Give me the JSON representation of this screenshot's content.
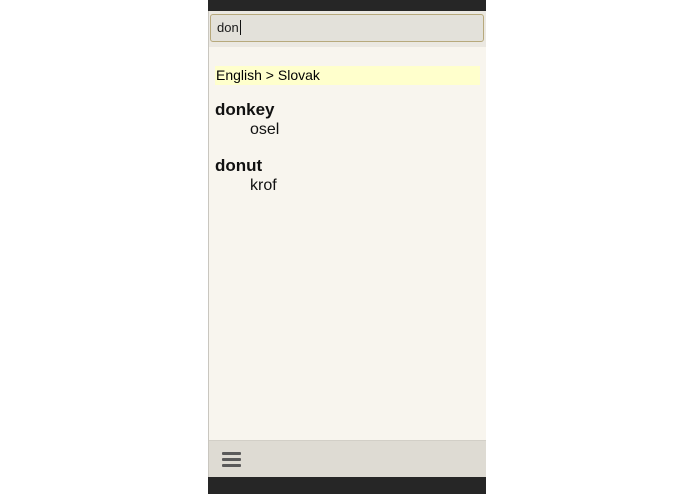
{
  "search": {
    "value": "don"
  },
  "results": {
    "direction_label": "English > Slovak",
    "entries": [
      {
        "headword": "donkey",
        "translation": "osel"
      },
      {
        "headword": "donut",
        "translation": "krof"
      }
    ]
  },
  "bottombar": {
    "menu_icon": "hamburger-menu-icon"
  },
  "colors": {
    "app_background": "#f8f5ee",
    "header_highlight": "#ffffcc",
    "search_border": "#b7a97c",
    "bottombar_background": "#dedbd3",
    "system_bar": "#262626"
  }
}
